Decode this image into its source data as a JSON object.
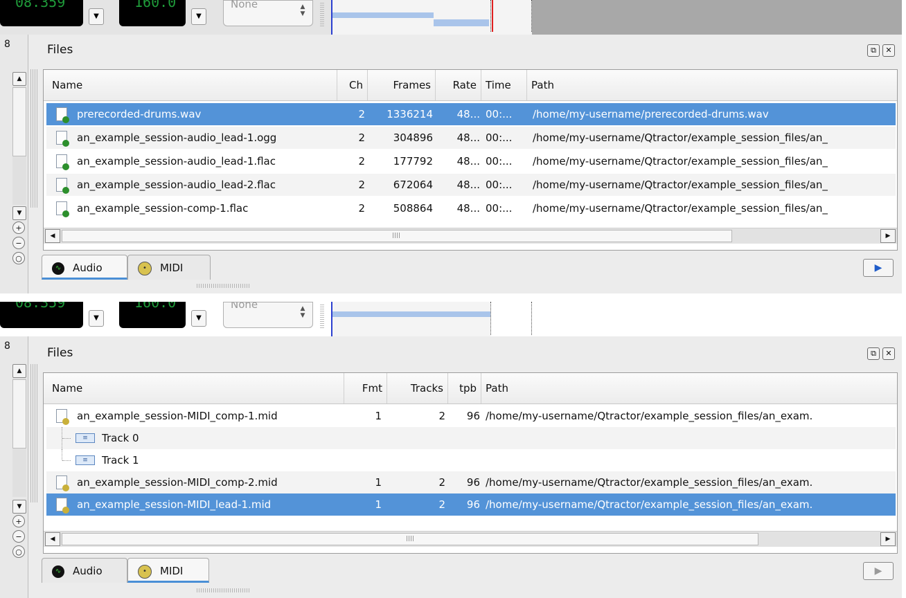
{
  "panels": [
    {
      "toolbar": {
        "time_display": "08.359",
        "tempo_display": "160.0",
        "snap_value": "None"
      },
      "ruler": {
        "marker": "8"
      },
      "dock": {
        "title": "Files",
        "float_icon": "float-icon",
        "close_icon": "close-icon"
      },
      "columns": [
        "Name",
        "Ch",
        "Frames",
        "Rate",
        "Time",
        "Path"
      ],
      "rows": [
        {
          "name": "prerecorded-drums.wav",
          "ch": "2",
          "frames": "1336214",
          "rate": "48...",
          "time": "00:...",
          "path": "/home/my-username/prerecorded-drums.wav",
          "selected": true
        },
        {
          "name": "an_example_session-audio_lead-1.ogg",
          "ch": "2",
          "frames": "304896",
          "rate": "48...",
          "time": "00:...",
          "path": "/home/my-username/Qtractor/example_session_files/an_"
        },
        {
          "name": "an_example_session-audio_lead-1.flac",
          "ch": "2",
          "frames": "177792",
          "rate": "48...",
          "time": "00:...",
          "path": "/home/my-username/Qtractor/example_session_files/an_"
        },
        {
          "name": "an_example_session-audio_lead-2.flac",
          "ch": "2",
          "frames": "672064",
          "rate": "48...",
          "time": "00:...",
          "path": "/home/my-username/Qtractor/example_session_files/an_"
        },
        {
          "name": "an_example_session-comp-1.flac",
          "ch": "2",
          "frames": "508864",
          "rate": "48...",
          "time": "00:...",
          "path": "/home/my-username/Qtractor/example_session_files/an_"
        }
      ],
      "tabs": [
        {
          "label": "Audio",
          "active": true
        },
        {
          "label": "MIDI",
          "active": false
        }
      ],
      "play_button": "play-icon"
    },
    {
      "toolbar": {
        "time_display": "08.359",
        "tempo_display": "160.0",
        "snap_value": "None"
      },
      "ruler": {
        "marker": "8"
      },
      "dock": {
        "title": "Files",
        "float_icon": "float-icon",
        "close_icon": "close-icon"
      },
      "columns": [
        "Name",
        "Fmt",
        "Tracks",
        "tpb",
        "Path"
      ],
      "rows": [
        {
          "name": "an_example_session-MIDI_comp-1.mid",
          "fmt": "1",
          "tracks": "2",
          "tpb": "96",
          "path": "/home/my-username/Qtractor/example_session_files/an_exam."
        },
        {
          "name": "Track 0",
          "child": true
        },
        {
          "name": "Track 1",
          "child": true
        },
        {
          "name": "an_example_session-MIDI_comp-2.mid",
          "fmt": "1",
          "tracks": "2",
          "tpb": "96",
          "path": "/home/my-username/Qtractor/example_session_files/an_exam."
        },
        {
          "name": "an_example_session-MIDI_lead-1.mid",
          "fmt": "1",
          "tracks": "2",
          "tpb": "96",
          "path": "/home/my-username/Qtractor/example_session_files/an_exam.",
          "selected": true
        }
      ],
      "tabs": [
        {
          "label": "Audio",
          "active": false
        },
        {
          "label": "MIDI",
          "active": true
        }
      ],
      "play_button": "play-icon"
    }
  ]
}
